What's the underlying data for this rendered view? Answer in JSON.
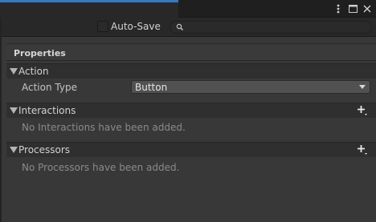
{
  "toolbar": {
    "autosave_label": "Auto-Save",
    "autosave_checked": false,
    "search_placeholder": ""
  },
  "window_buttons": {
    "menu_icon": "kebab-menu-icon",
    "maximize_icon": "maximize-icon",
    "close_icon": "close-icon"
  },
  "panel": {
    "title": "Properties",
    "sections": {
      "action": {
        "title": "Action",
        "action_type_label": "Action Type",
        "action_type_value": "Button"
      },
      "interactions": {
        "title": "Interactions",
        "empty_text": "No Interactions have been added."
      },
      "processors": {
        "title": "Processors",
        "empty_text": "No Processors have been added."
      }
    }
  },
  "colors": {
    "background": "#383838",
    "toolbar": "#282828",
    "section_header": "#2f2f2f",
    "dropdown": "#515151",
    "accent": "#3a79bb"
  }
}
